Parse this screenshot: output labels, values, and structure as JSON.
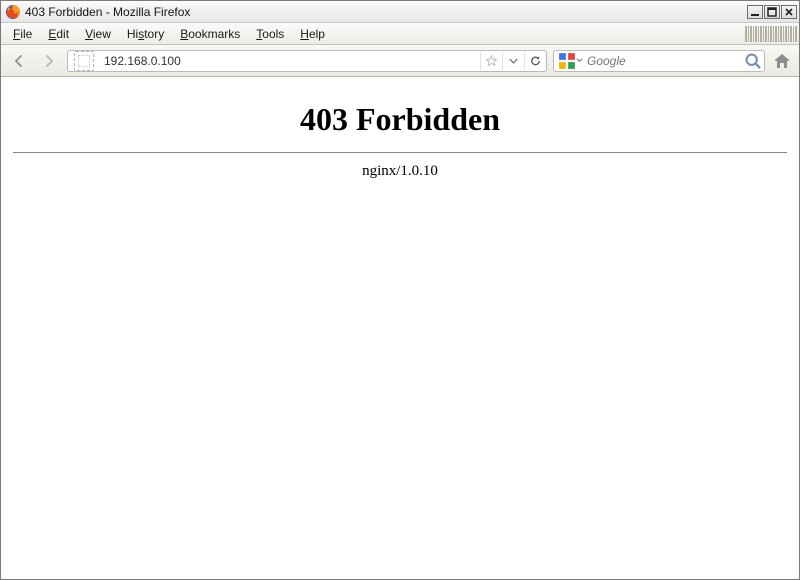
{
  "window": {
    "title": "403 Forbidden - Mozilla Firefox"
  },
  "menus": {
    "file": "File",
    "edit": "Edit",
    "view": "View",
    "history": "History",
    "bookmarks": "Bookmarks",
    "tools": "Tools",
    "help": "Help"
  },
  "address_bar": {
    "url": "192.168.0.100"
  },
  "search": {
    "placeholder": "Google"
  },
  "page": {
    "heading": "403 Forbidden",
    "server": "nginx/1.0.10"
  }
}
